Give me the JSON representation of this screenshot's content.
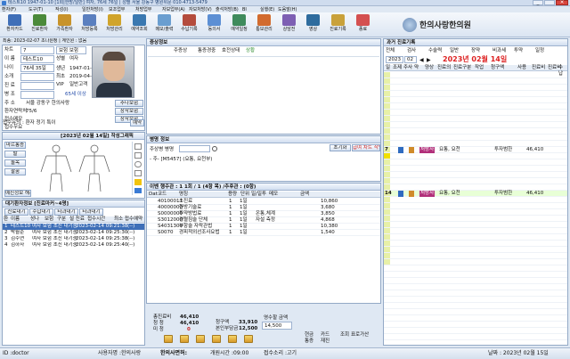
{
  "window": {
    "title": "테스트10 1947-01-10 [1회|한방/일반] 여자, 76세 76일 | 성별 서울 강동구 병원위문 010-4713-5479",
    "controls": [
      "_",
      "□",
      "✕"
    ]
  },
  "menu": [
    "환자(F)",
    "도구(T)",
    "작성(I)",
    "일반처방(I)",
    "보조업무",
    "처방업무",
    "자보업무(A)",
    "자보처방(V)",
    "출석처방(B)",
    "BI",
    "실행(E)",
    "도움말(H)"
  ],
  "toolbar": [
    {
      "label": "환자카드",
      "color": "#3f6fb8"
    },
    {
      "label": "진료환자",
      "color": "#4b8a3a"
    },
    {
      "label": "가족환자",
      "color": "#c8932a"
    },
    {
      "label": "처방등록",
      "color": "#5a7fbf"
    },
    {
      "label": "처방관리",
      "color": "#d0a42b"
    },
    {
      "label": "예약조회",
      "color": "#3a78b0"
    },
    {
      "label": "메모/출력",
      "color": "#6a9ed0"
    },
    {
      "label": "수납기록",
      "color": "#b44c3d"
    },
    {
      "label": "동의서",
      "color": "#5c8fd4"
    },
    {
      "label": "예약일정",
      "color": "#3f8b5c"
    },
    {
      "label": "통보관리",
      "color": "#d26b2e"
    },
    {
      "label": "상담전",
      "color": "#7d5fb3"
    },
    {
      "label": "영상",
      "color": "#2f6c9e"
    },
    {
      "label": "진료기록",
      "color": "#c9a13a"
    },
    {
      "label": "종료",
      "color": "#d45050"
    }
  ],
  "clinic_name": "한의사랑한의원",
  "patient": {
    "header": "최종: 2023-02-07 초나원정 | 계인원 : 없음",
    "fields": [
      {
        "label": "차트",
        "value": "7"
      },
      {
        "label": "이 름",
        "value": "테스트10"
      },
      {
        "label": "나이",
        "value": "76세 35일"
      },
      {
        "label": "소개",
        "value": ""
      },
      {
        "label": "진 료",
        "value": ""
      },
      {
        "label": "병 조",
        "value": ""
      }
    ],
    "chart_label": "보험",
    "chart_value": "보험 보험",
    "sex_label": "성별",
    "sex_value": "여자",
    "birth_label": "생년",
    "birth_value": "1947-01-10",
    "first_label": "최초",
    "first_value": "2019-04-25",
    "type_label": "VIP",
    "type_value": "일반고객",
    "weight": "65세 이상",
    "address": "서울 강동구 한의사랑",
    "address_label": "주 소",
    "phone_label": "환자연락처",
    "phone_value": "75/6",
    "memo_labels": [
      "접수메모",
      "접수우요"
    ],
    "right_buttons": [
      "추나보험",
      "장작보험",
      "장작보험"
    ],
    "receipt": "접수유의 :  환자 정기  특이",
    "reserve_label": "예약"
  },
  "body_chart": {
    "title": "[2023년 02월 14일] 작성그래픽",
    "left_tabs": [
      "마르통증",
      "발",
      "돌목",
      "팔꿈"
    ],
    "bottom_button": "예진정보 해제"
  },
  "visit": {
    "title": "대기환자정보 [진료마커~4명]",
    "tabs": [
      "진료대기",
      "수납대기",
      "타과대기",
      "타과대기"
    ],
    "columns": [
      "환",
      "이름",
      "성나",
      "보험",
      "구분",
      "설 진료",
      "접수시간",
      "최소 접수예약"
    ],
    "rows": [
      {
        "n": "1",
        "name": "테스트10",
        "info": "여자 보험  초진 대기중",
        "time": "2023-02-14 09:21:38",
        "extra": "(--)"
      },
      {
        "n": "2",
        "name": "박월순",
        "info": "여자 보험  초진 대기중",
        "time": "2023-02-14 09:25:30",
        "extra": "(--)"
      },
      {
        "n": "3",
        "name": "김수연",
        "info": "여자 보험  초진 대기중",
        "time": "2023-02-14 09:25:38",
        "extra": "(--)"
      },
      {
        "n": "4",
        "name": "김하자",
        "info": "여자 보험  초진 대기중",
        "time": "2023-02-14 09:25:40",
        "extra": "(--)"
      }
    ]
  },
  "symptom": {
    "title": "증상정보",
    "tabs": [
      "주증상",
      "통증경중",
      "호전상태",
      "상황"
    ]
  },
  "diag": {
    "title": "병명 정보",
    "buttons": [
      "초기화",
      "급여 차트 작업"
    ],
    "input_label": "주상병 병명",
    "entry": "- 주- [M5457] (요통, 요천부)"
  },
  "order": {
    "title": "이벤 행주관 : 1 1회 /  1 (4항 목) /추후관 : (0항)",
    "columns": [
      "Dat",
      "코드",
      "명칭",
      "용량",
      "단위",
      "일/일투",
      "메모",
      "금액"
    ],
    "rows": [
      {
        "code": "40100011",
        "name": "초진료",
        "unit": "1",
        "days": "1일",
        "memo": "",
        "amt": "10,860"
      },
      {
        "code": "40000000",
        "name": "한방기술료",
        "unit": "1",
        "days": "1일",
        "memo": "",
        "amt": "3,680"
      },
      {
        "code": "S0000000",
        "name": "투약방법료",
        "unit": "1",
        "days": "1일",
        "memo": "온통,체계",
        "amt": "3,850"
      },
      {
        "code": "S3012000",
        "name": "경혈침술 단체",
        "unit": "1",
        "days": "1일",
        "memo": "자설 측정",
        "amt": "4,868"
      },
      {
        "code": "S4031300",
        "name": "부항술 자락관법",
        "unit": "1",
        "days": "1일",
        "memo": "",
        "amt": "10,380"
      },
      {
        "code": "S0070",
        "name": "경피적외선조사요법",
        "unit": "1",
        "days": "1일",
        "memo": "",
        "amt": "1,540"
      }
    ]
  },
  "bill": {
    "total_label": "총진료비",
    "total": "46,410",
    "patient_label": "청 청",
    "patient": "46,410",
    "unpaid_label": "미 청",
    "unpaid": "0",
    "due_label": "청구액",
    "due": "33,910",
    "self_label": "본인부담금",
    "self": "12,500",
    "receipt_label": "영수할 금액",
    "receipt": "14,500",
    "opt1": "현금",
    "opt2": "카드",
    "check1": "통증",
    "check2": "재진",
    "check3": "조회",
    "check4": "표로가산"
  },
  "history": {
    "title": "과거 진료기록",
    "filters": [
      "전체",
      "검사",
      "수술력",
      "일반",
      "장약",
      "비과세",
      "투약",
      "일정"
    ],
    "year": "2023",
    "month": "02",
    "day_text": "2023년 02월 14일",
    "columns": [
      "일",
      "조제",
      "주사",
      "약",
      "양상",
      "진료의",
      "진료구분",
      "작업",
      "청구액",
      "사용",
      "진료비",
      "진료비",
      "수납"
    ],
    "today": "14",
    "entry1": {
      "no": "7",
      "badge": "처방사",
      "text": "요통, 요천",
      "kind": "투자범한",
      "amt": "46,410"
    },
    "entry2": {
      "no": "14",
      "badge": "처방사",
      "text": "요통, 요천",
      "kind": "투자범한",
      "amt": "46,410"
    }
  },
  "status": {
    "id": "ID :doctor",
    "user": "사용자명 :한의사랑",
    "clinic": "한의사면허:",
    "time": "개원시간 :09:00",
    "waiting": "접수소리 :고기",
    "date": "날짜 : 2023년 02월 15일"
  }
}
